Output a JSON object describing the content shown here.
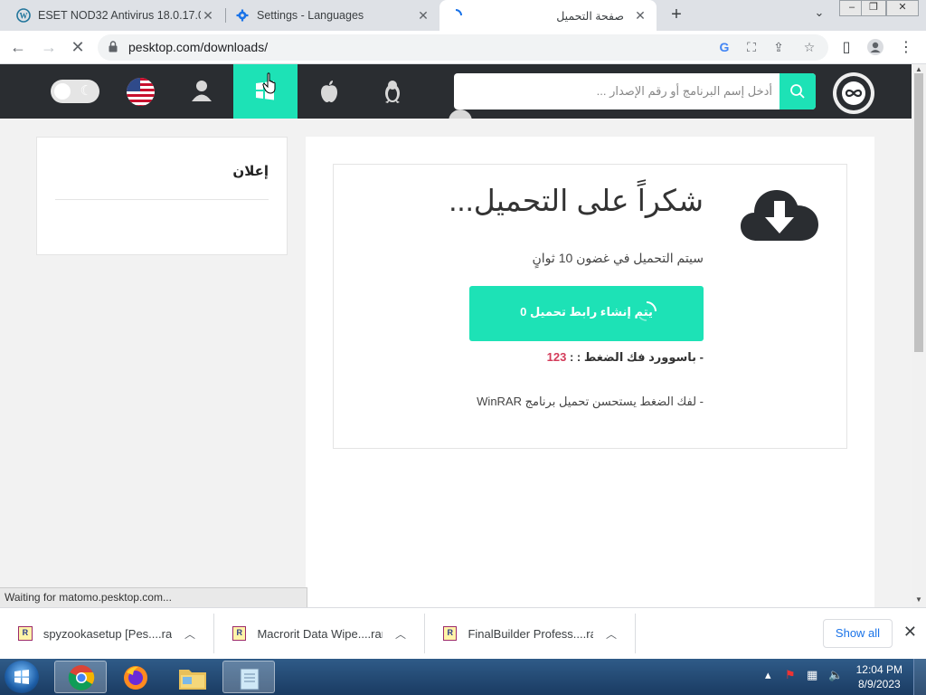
{
  "browser": {
    "tabs": [
      {
        "title": "ESET NOD32 Antivirus 18.0.17.0 (",
        "favicon": "wordpress-icon"
      },
      {
        "title": "Settings - Languages",
        "favicon": "gear-icon"
      },
      {
        "title": "صفحة التحميل",
        "favicon": "loading-spinner-icon"
      }
    ],
    "url": "pesktop.com/downloads/",
    "status": "Waiting for matomo.pesktop.com..."
  },
  "site": {
    "search_placeholder": "أدخل إسم البرنامج أو رقم الإصدار ...",
    "accent": "#1de2b6",
    "header_bg": "#2a2d31"
  },
  "sidebar": {
    "ad_title": "إعلان"
  },
  "download": {
    "heading": "شكراً على التحميل...",
    "subtitle": "سيتم التحميل في غضون 10 ثوانٍ",
    "button_label": "يتم إنشاء رابط تحميل 0",
    "password_label": "- باسوورد فك الضغط : : ",
    "password_value": "123",
    "winrar_note": "- لفك الضغط يستحسن تحميل برنامج WinRAR"
  },
  "downloads_shelf": {
    "items": [
      {
        "name": "spyzookasetup [Pes....rar"
      },
      {
        "name": "Macrorit Data Wipe....rar"
      },
      {
        "name": "FinalBuilder Profess....rar"
      }
    ],
    "show_all": "Show all"
  },
  "taskbar": {
    "time": "12:04 PM",
    "date": "8/9/2023"
  }
}
